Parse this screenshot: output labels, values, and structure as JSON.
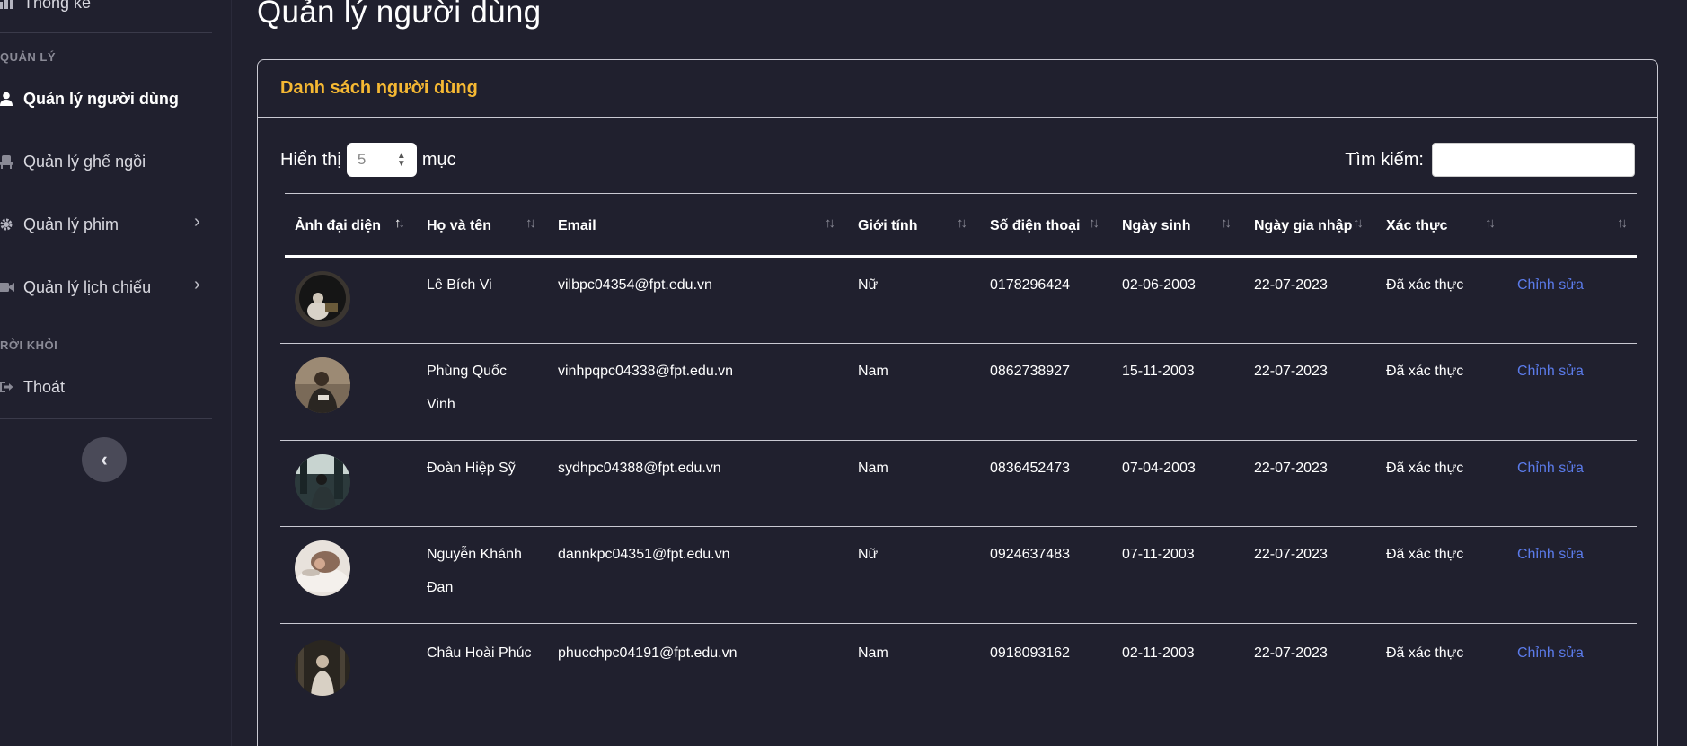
{
  "sidebar": {
    "top_item": "Thống kê",
    "section_manage": "QUẢN LÝ",
    "items": [
      {
        "label": "Quản lý người dùng",
        "icon": "user-icon"
      },
      {
        "label": "Quản lý ghế ngồi",
        "icon": "chair-icon"
      },
      {
        "label": "Quản lý phim",
        "icon": "gear-icon"
      },
      {
        "label": "Quản lý lịch chiếu",
        "icon": "video-camera-icon"
      }
    ],
    "section_exit": "RỜI KHỎI",
    "logout": "Thoát",
    "collapse": "‹"
  },
  "page": {
    "title": "Quản lý người dùng"
  },
  "card": {
    "title": "Danh sách người dùng",
    "length_prefix": "Hiển thị",
    "length_value": "5",
    "length_suffix": "mục",
    "search_label": "Tìm kiếm:",
    "search_value": ""
  },
  "table": {
    "headers": [
      "Ảnh đại diện",
      "Họ và tên",
      "Email",
      "Giới tính",
      "Số điện thoại",
      "Ngày sinh",
      "Ngày gia nhập",
      "Xác thực",
      ""
    ],
    "rows": [
      {
        "name_line1": "Lê Bích Vi",
        "name_line2": "",
        "email": "vilbpc04354@fpt.edu.vn",
        "gender": "Nữ",
        "phone": "0178296424",
        "dob": "02-06-2003",
        "joined": "22-07-2023",
        "verified": "Đã xác thực",
        "action": "Chỉnh sửa"
      },
      {
        "name_line1": "Phùng Quốc",
        "name_line2": "Vinh",
        "email": "vinhpqpc04338@fpt.edu.vn",
        "gender": "Nam",
        "phone": "0862738927",
        "dob": "15-11-2003",
        "joined": "22-07-2023",
        "verified": "Đã xác thực",
        "action": "Chỉnh sửa"
      },
      {
        "name_line1": "Đoàn Hiệp Sỹ",
        "name_line2": "",
        "email": "sydhpc04388@fpt.edu.vn",
        "gender": "Nam",
        "phone": "0836452473",
        "dob": "07-04-2003",
        "joined": "22-07-2023",
        "verified": "Đã xác thực",
        "action": "Chỉnh sửa"
      },
      {
        "name_line1": "Nguyễn Khánh",
        "name_line2": "Đan",
        "email": "dannkpc04351@fpt.edu.vn",
        "gender": "Nữ",
        "phone": "0924637483",
        "dob": "07-11-2003",
        "joined": "22-07-2023",
        "verified": "Đã xác thực",
        "action": "Chỉnh sửa"
      },
      {
        "name_line1": "Châu Hoài Phúc",
        "name_line2": "",
        "email": "phucchpc04191@fpt.edu.vn",
        "gender": "Nam",
        "phone": "0918093162",
        "dob": "02-11-2003",
        "joined": "22-07-2023",
        "verified": "Đã xác thực",
        "action": "Chỉnh sửa"
      }
    ]
  },
  "colors": {
    "background": "#20202e",
    "accent": "#f5b833",
    "link": "#5b7bea"
  }
}
